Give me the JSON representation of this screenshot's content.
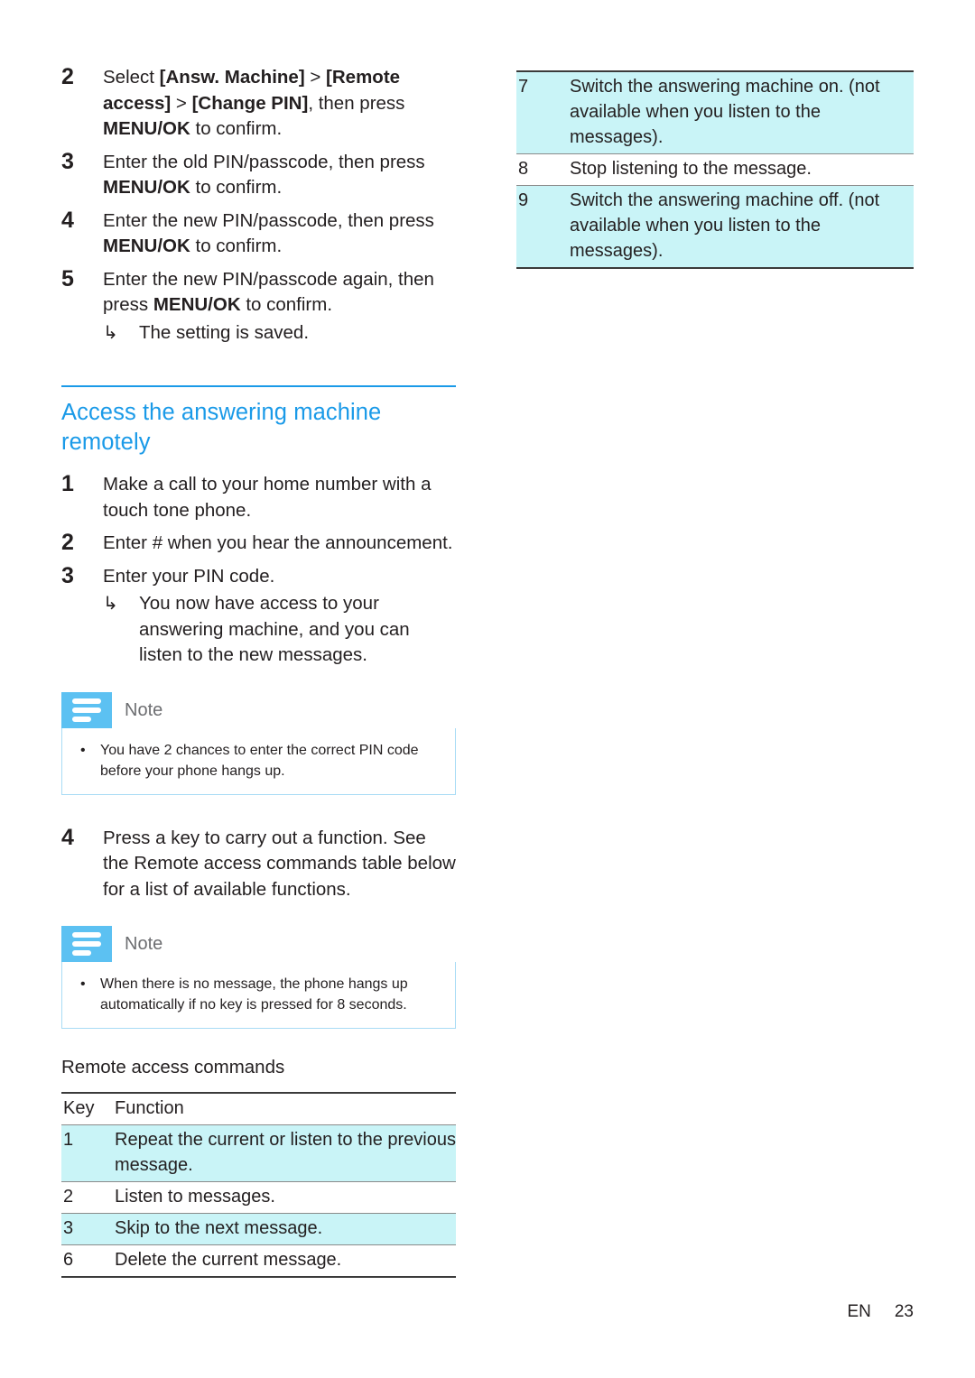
{
  "page": {
    "footer_language": "EN",
    "footer_page_number": "23",
    "accent_blue": "#1a9ae8",
    "note_tab_blue": "#5cc1f2",
    "table_highlight": "#c9f4f7"
  },
  "left_column": {
    "steps_change_pin": [
      {
        "num": "2",
        "parts": [
          {
            "text": "Select ",
            "bold": false
          },
          {
            "text": "[Answ. Machine]",
            "bold": true
          },
          {
            "text": " > ",
            "bold": false
          },
          {
            "text": "[Remote access]",
            "bold": true
          },
          {
            "text": " > ",
            "bold": false
          },
          {
            "text": "[Change PIN]",
            "bold": true
          },
          {
            "text": ", then press ",
            "bold": false
          },
          {
            "text": "MENU/OK",
            "bold": true
          },
          {
            "text": " to confirm.",
            "bold": false
          }
        ]
      },
      {
        "num": "3",
        "parts": [
          {
            "text": "Enter the old PIN/passcode, then press ",
            "bold": false
          },
          {
            "text": "MENU/OK",
            "bold": true
          },
          {
            "text": " to confirm.",
            "bold": false
          }
        ]
      },
      {
        "num": "4",
        "parts": [
          {
            "text": "Enter the new PIN/passcode, then press ",
            "bold": false
          },
          {
            "text": "MENU/OK",
            "bold": true
          },
          {
            "text": " to confirm.",
            "bold": false
          }
        ]
      },
      {
        "num": "5",
        "parts": [
          {
            "text": "Enter the new PIN/passcode again, then press ",
            "bold": false
          },
          {
            "text": "MENU/OK",
            "bold": true
          },
          {
            "text": " to confirm.",
            "bold": false
          }
        ],
        "result": {
          "arrow": "↳",
          "text": "The setting is saved."
        }
      }
    ],
    "section_heading": "Access the answering machine remotely",
    "steps_remote_access": [
      {
        "num": "1",
        "parts": [
          {
            "text": "Make a call to your home number with a touch tone phone.",
            "bold": false
          }
        ]
      },
      {
        "num": "2",
        "parts": [
          {
            "text": "Enter # when you hear the announcement.",
            "bold": false
          }
        ]
      },
      {
        "num": "3",
        "parts": [
          {
            "text": "Enter your PIN code.",
            "bold": false
          }
        ],
        "result": {
          "arrow": "↳",
          "text": "You now have access to your answering machine, and you can listen to the new messages."
        }
      }
    ],
    "note_1": {
      "title": "Note",
      "icon": "note-lines-icon",
      "bullet": "•",
      "text": "You have 2 chances to enter the correct PIN code before your phone hangs up."
    },
    "step_4": {
      "num": "4",
      "parts": [
        {
          "text": "Press a key to carry out a function. See the Remote access commands table below for a list of available functions.",
          "bold": false
        }
      ]
    },
    "note_2": {
      "title": "Note",
      "icon": "note-lines-icon",
      "bullet": "•",
      "text": "When there is no message, the phone hangs up automatically if no key is pressed for 8 seconds."
    },
    "table": {
      "title": "Remote access commands",
      "headers": [
        "Key",
        "Function"
      ],
      "rows": [
        {
          "key": "1",
          "function": "Repeat the current or listen to the previous message.",
          "highlight": true
        },
        {
          "key": "2",
          "function": "Listen to messages.",
          "highlight": false
        },
        {
          "key": "3",
          "function": "Skip to the next message.",
          "highlight": true
        },
        {
          "key": "6",
          "function": "Delete the current message.",
          "highlight": false
        }
      ]
    }
  },
  "right_column": {
    "table": {
      "rows": [
        {
          "key": "7",
          "function": "Switch the answering machine on. (not available when you listen to the messages).",
          "highlight": true
        },
        {
          "key": "8",
          "function": "Stop listening to the message.",
          "highlight": false
        },
        {
          "key": "9",
          "function": "Switch the answering machine off. (not available when you listen to the messages).",
          "highlight": true
        }
      ]
    }
  }
}
